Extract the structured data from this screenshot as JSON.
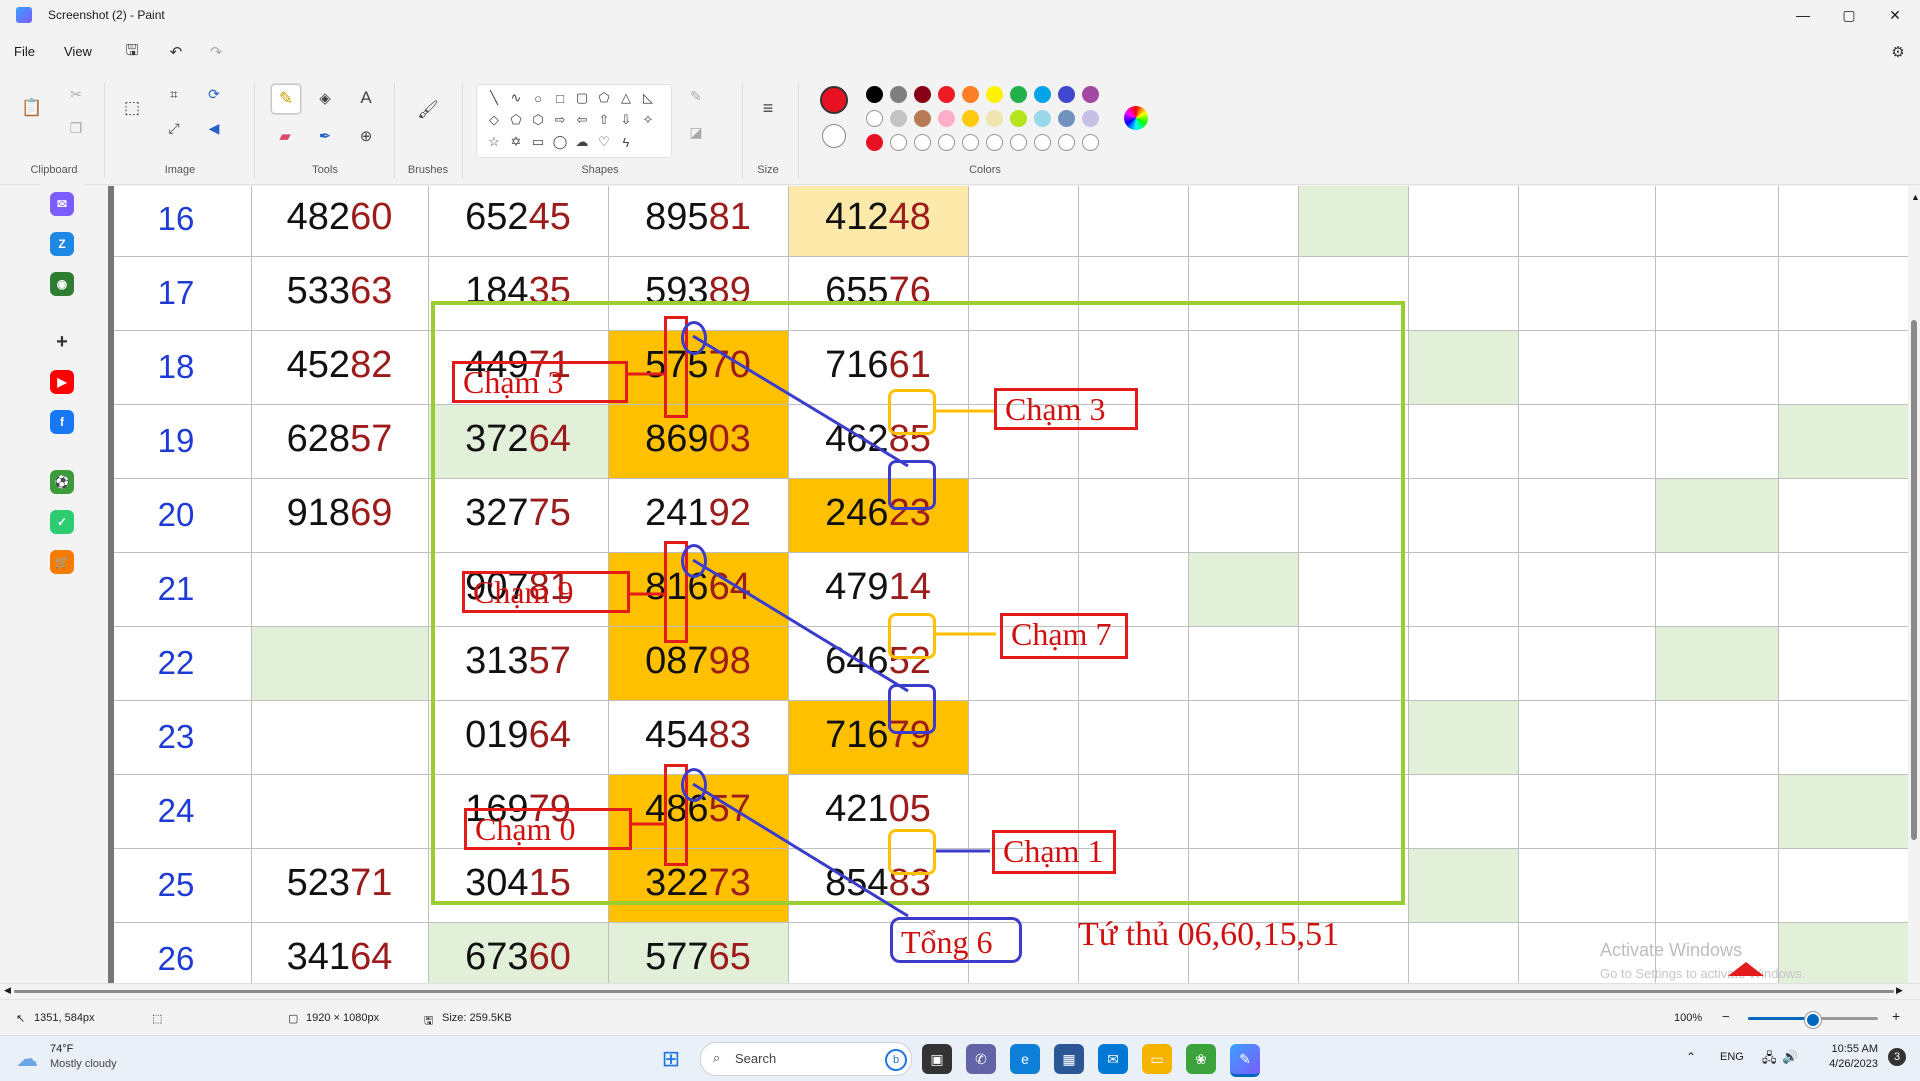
{
  "window": {
    "title": "Screenshot (2) - Paint",
    "minimize": "—",
    "maximize": "▢",
    "close": "✕"
  },
  "menu": {
    "file": "File",
    "view": "View"
  },
  "ribbon": {
    "groups": {
      "clipboard": "Clipboard",
      "image": "Image",
      "tools": "Tools",
      "brushes": "Brushes",
      "shapes": "Shapes",
      "size": "Size",
      "colors": "Colors"
    },
    "tool_text_glyph": "A",
    "colors": {
      "primary": "#e81123",
      "secondary": "#ffffff",
      "row1": [
        "#000000",
        "#7f7f7f",
        "#880015",
        "#ed1c24",
        "#ff7f27",
        "#fff200",
        "#22b14c",
        "#00a2e8",
        "#3f48cc",
        "#a349a4"
      ],
      "row2": [
        "#ffffff",
        "#c3c3c3",
        "#b97a57",
        "#ffaec9",
        "#ffc90e",
        "#efe4b0",
        "#b5e61d",
        "#99d9ea",
        "#7092be",
        "#c8bfe7"
      ],
      "row3": [
        "#e81123",
        "#ffffff",
        "#ffffff",
        "#ffffff",
        "#ffffff",
        "#ffffff",
        "#ffffff",
        "#ffffff",
        "#ffffff",
        "#ffffff"
      ]
    }
  },
  "sheet": {
    "rows": [
      {
        "num": "16",
        "cols": [
          "48260",
          "65245",
          "89581",
          "41248"
        ]
      },
      {
        "num": "17",
        "cols": [
          "53363",
          "18435",
          "59389",
          "65576"
        ]
      },
      {
        "num": "18",
        "cols": [
          "45282",
          "44971",
          "57570",
          "71661"
        ]
      },
      {
        "num": "19",
        "cols": [
          "62857",
          "37264",
          "86903",
          "46285"
        ]
      },
      {
        "num": "20",
        "cols": [
          "91869",
          "32775",
          "24192",
          "24623"
        ]
      },
      {
        "num": "21",
        "cols": [
          "",
          "90781",
          "81664",
          "47914"
        ]
      },
      {
        "num": "22",
        "cols": [
          "",
          "31357",
          "08798",
          "64652"
        ]
      },
      {
        "num": "23",
        "cols": [
          "",
          "01964",
          "45483",
          "71679"
        ]
      },
      {
        "num": "24",
        "cols": [
          "",
          "16979",
          "48657",
          "42105"
        ]
      },
      {
        "num": "25",
        "cols": [
          "52371",
          "30415",
          "32273",
          "85483"
        ]
      },
      {
        "num": "26",
        "cols": [
          "34164",
          "67360",
          "57765",
          ""
        ]
      }
    ],
    "annotations": {
      "left1": "Chạm 3",
      "left2": "Chạm 9",
      "left3": "Chạm 0",
      "right1": "Chạm 3",
      "right2": "Chạm 7",
      "right3": "Chạm 1",
      "tong": "Tổng 6",
      "tuthu": "Tứ thủ 06,60,15,51"
    },
    "watermark": {
      "line1": "Activate Windows",
      "line2": "Go to Settings to activate Windows."
    }
  },
  "status": {
    "cursor": "1351, 584px",
    "dimensions": "1920 × 1080px",
    "size": "Size: 259.5KB",
    "zoom": "100%",
    "zoom_level": 0.5
  },
  "taskbar": {
    "weather_temp": "74°F",
    "weather_desc": "Mostly cloudy",
    "search": "Search",
    "lang": "ENG",
    "time": "10:55 AM",
    "date": "4/26/2023",
    "badge": "3"
  }
}
